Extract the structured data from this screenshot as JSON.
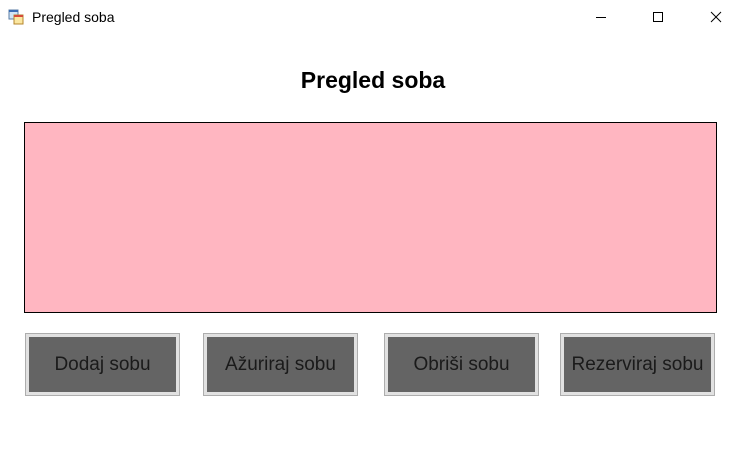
{
  "window": {
    "title": "Pregled soba",
    "icon": "app-window-icon",
    "controls": [
      "minimize-icon",
      "maximize-icon",
      "close-icon"
    ]
  },
  "main": {
    "heading": "Pregled soba",
    "grid_background": "#ffb6c1"
  },
  "actions": {
    "add": "Dodaj sobu",
    "update": "Ažuriraj sobu",
    "delete": "Obriši sobu",
    "reserve": "Rezerviraj sobu"
  },
  "colors": {
    "button_face": "#646464",
    "button_border": "#adadad",
    "grid": "#ffb6c1"
  }
}
